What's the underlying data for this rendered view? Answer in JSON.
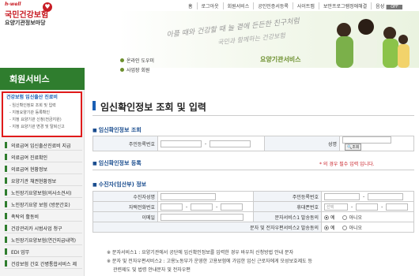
{
  "header": {
    "logo_small": "h-well",
    "logo_main": "국민건강보험",
    "logo_sub": "요양기관정보마당",
    "top_nav": [
      "홈",
      "로그아웃",
      "회원서비스",
      "공인인증서등록",
      "사이트맵",
      "보안프로그램정애해결",
      "음성"
    ],
    "voice_state": "OFF",
    "tagline1": "아플 때와 건강할 때 늘 곁에 든든한 친구처럼",
    "tagline2": "국민과 함께하는 건강보험",
    "quick_links": [
      "온라인 도우미",
      "사업장 회원"
    ],
    "brand": "요양기관서비스"
  },
  "sidebar": {
    "title": "회원서비스",
    "selected_group": "건강보험 임신출산 진료비",
    "sub_items": [
      "임신확인정보 조회 및 입력",
      "지정요양기관 등록확인",
      "지정 요양기관 신청(전금지원)",
      "지정 요양기관 변경 및 탈퇴신고"
    ],
    "menu": [
      "의료급여 임신출산진료비 지급",
      "의료급여 진료확인",
      "의료급여 현황정보",
      "요양기관 채권현황정보",
      "노인장기요양보험(의사소견서)",
      "노인장기요양 보험 (방문간호)",
      "촉탁의 활동비",
      "건강관리카 시범사업 청구",
      "노인장기요양보험(연간지급내역)",
      "EDI 업무",
      "건강보험 간호 간병통합서비스 제"
    ]
  },
  "main": {
    "title": "임신확인정보 조회 및 입력",
    "search": {
      "section": "임신확인정보 조회",
      "rrn_label": "주민등록번호",
      "name_label": "성명",
      "search_button": "조회"
    },
    "register": {
      "section": "임신확인정보 등록",
      "note": "* 의 경우 필수 입력 입니다."
    },
    "recipient": {
      "section": "수진자(임산부) 정보",
      "name_label": "수진자성명",
      "rrn_label": "주민등록번호",
      "home_phone_label": "자택전화번호",
      "mobile_label": "휴대폰번호",
      "mobile_select": "선택",
      "email_label": "이메일",
      "sms1_label": "문자서비스1 발송동의",
      "sms2_label": "문자 및 전자우편서비스2 발송동의",
      "yes": "예",
      "no": "아니오"
    },
    "footnotes": [
      "※ 문자서비스1 : 요양기관에서 공단에 임신확인정보를 입력한 경우 바우처 신청방법 안내 문자",
      "※ 문자 및 전자우편서비스2 : 고용노동부가 운영한 고용보험에 가입한 임신 근로자에게 모성보호제도 등",
      "관련제도 및 법령 안내문자 및 전자우편"
    ]
  },
  "colors": {
    "accent_green": "#2f7d2e",
    "brand_red": "#c81d25",
    "highlight": "#e01b1b",
    "section_blue": "#1a4d8f"
  }
}
